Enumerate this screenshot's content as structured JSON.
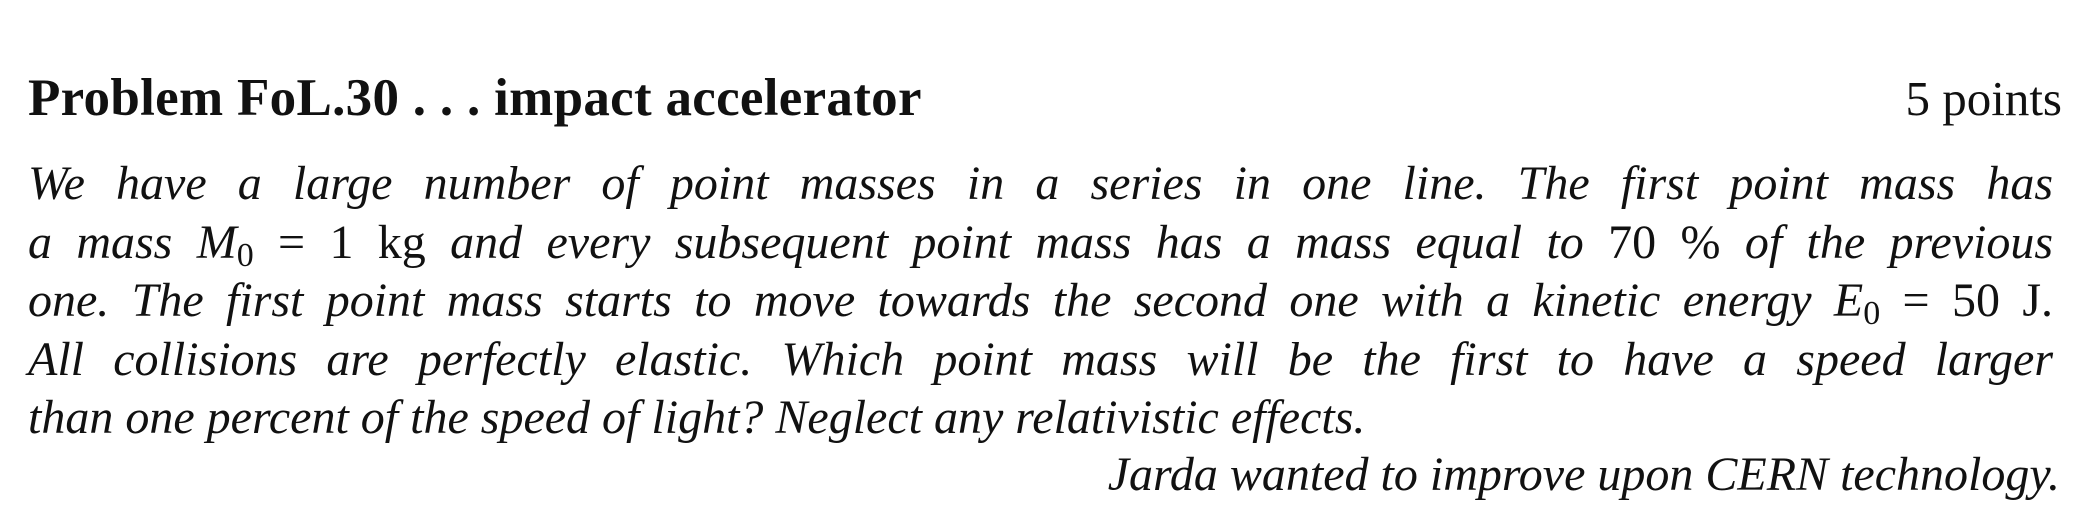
{
  "problem": {
    "title": "Problem FoL.30 . . . impact accelerator",
    "points": "5 points",
    "lines": [
      "We have a large number of point masses in a series in one line. The first point mass has",
      {
        "parts": [
          "a mass ",
          "M",
          "0",
          " = 1 kg",
          " and every subsequent point mass has a mass equal to ",
          "70 %",
          " of the previous"
        ]
      },
      {
        "parts": [
          "one. The first point mass starts to move towards the second one with a kinetic energy ",
          "E",
          "0",
          " = 50 J",
          "."
        ]
      },
      "All collisions are perfectly elastic. Which point mass will be the first to have a speed larger",
      "than one percent of the speed of light? Neglect any relativistic effects."
    ],
    "author_note": "Jarda wanted to improve upon CERN technology."
  }
}
